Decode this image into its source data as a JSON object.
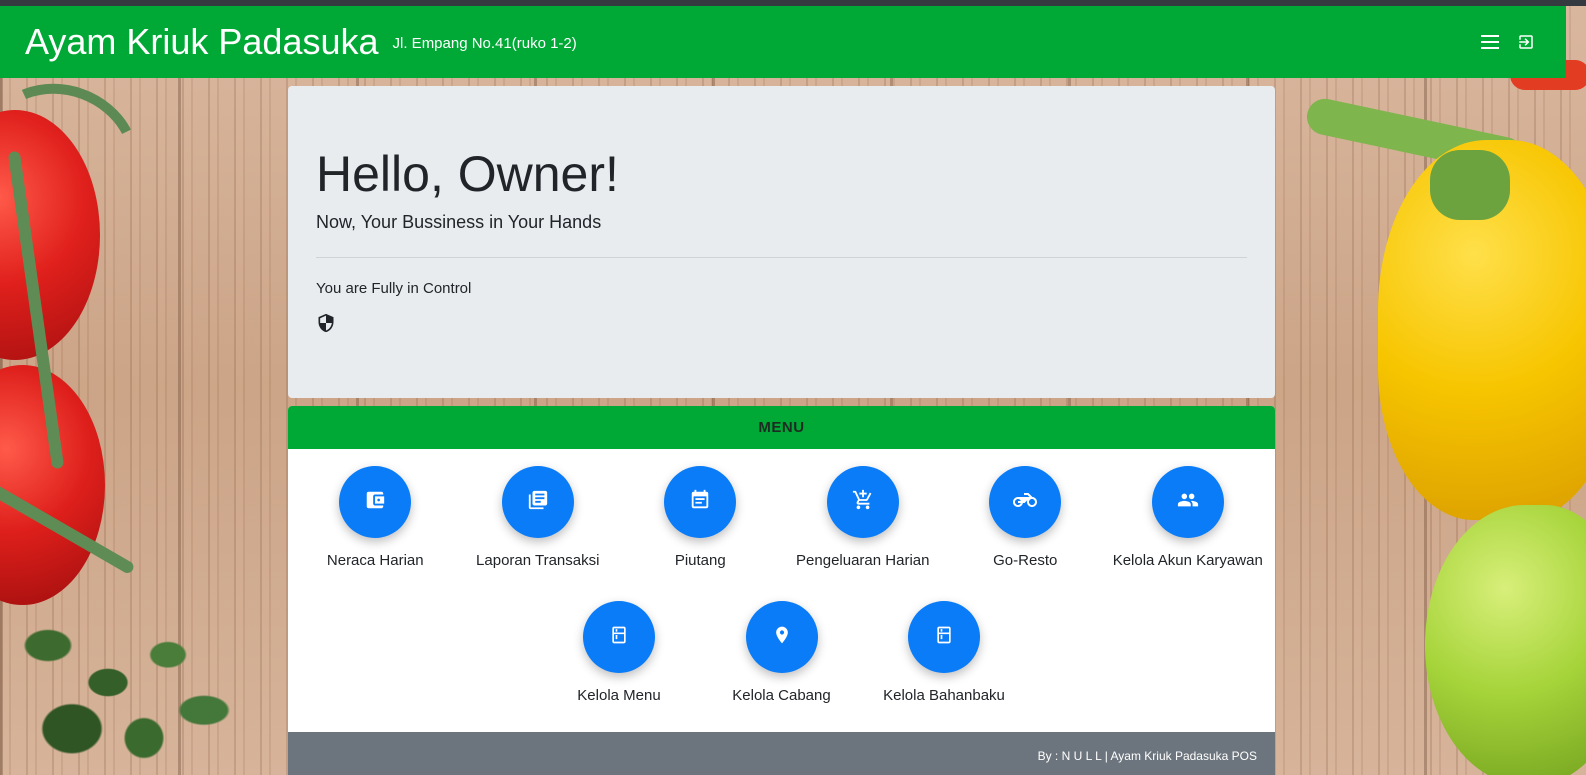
{
  "navbar": {
    "brand": "Ayam Kriuk Padasuka",
    "address": "Jl. Empang No.41(ruko 1-2)",
    "menu_icon": "hamburger-menu-icon",
    "logout_icon": "logout-icon"
  },
  "jumbotron": {
    "title": "Hello, Owner!",
    "lead": "Now, Your Bussiness in Your Hands",
    "control": "You are Fully in Control",
    "icon": "shield-icon"
  },
  "menu": {
    "header": "MENU",
    "items": [
      {
        "label": "Neraca Harian",
        "icon": "wallet-icon"
      },
      {
        "label": "Laporan Transaksi",
        "icon": "library-books-icon"
      },
      {
        "label": "Piutang",
        "icon": "event-note-icon"
      },
      {
        "label": "Pengeluaran Harian",
        "icon": "add-shopping-cart-icon"
      },
      {
        "label": "Go-Resto",
        "icon": "motorcycle-icon"
      },
      {
        "label": "Kelola Akun Karyawan",
        "icon": "people-icon"
      },
      {
        "label": "Kelola Menu",
        "icon": "kitchen-icon"
      },
      {
        "label": "Kelola Cabang",
        "icon": "location-pin-icon"
      },
      {
        "label": "Kelola Bahanbaku",
        "icon": "kitchen-icon"
      }
    ]
  },
  "footer": {
    "text": "By : N U L L | Ayam Kriuk Padasuka POS"
  },
  "colors": {
    "primary_green": "#00a935",
    "button_blue": "#0a7cf8",
    "jumbotron_bg": "#e9ecef",
    "footer_bg": "#6c757d"
  }
}
